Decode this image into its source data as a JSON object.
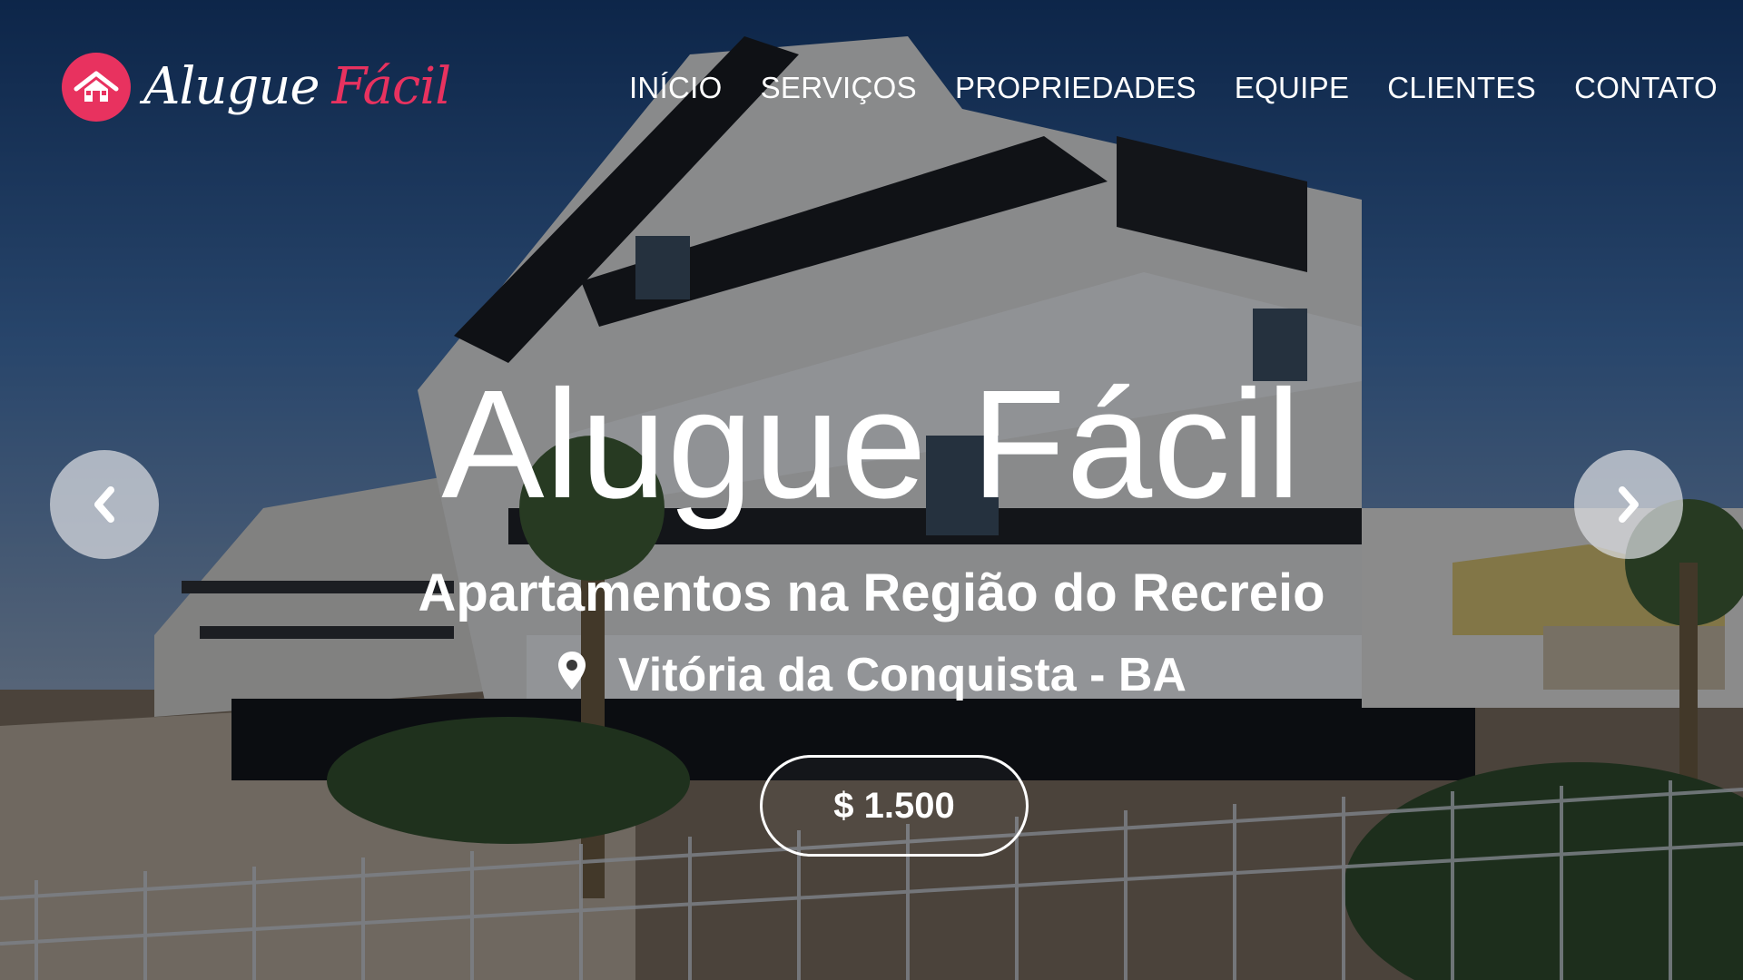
{
  "brand": {
    "name_part1": "Alugue",
    "name_part2": "Fácil",
    "accent_color": "#e8325f"
  },
  "nav": {
    "items": [
      {
        "label": "INÍCIO"
      },
      {
        "label": "SERVIÇOS"
      },
      {
        "label": "PROPRIEDADES"
      },
      {
        "label": "EQUIPE"
      },
      {
        "label": "CLIENTES"
      },
      {
        "label": "CONTATO"
      }
    ]
  },
  "slide": {
    "title": "Alugue Fácil",
    "subtitle": "Apartamentos na Região do Recreio",
    "location": "Vitória da Conquista - BA",
    "price": "$ 1.500"
  },
  "icons": {
    "logo": "house-icon",
    "location": "map-pin-icon",
    "prev": "chevron-left-icon",
    "next": "chevron-right-icon"
  }
}
